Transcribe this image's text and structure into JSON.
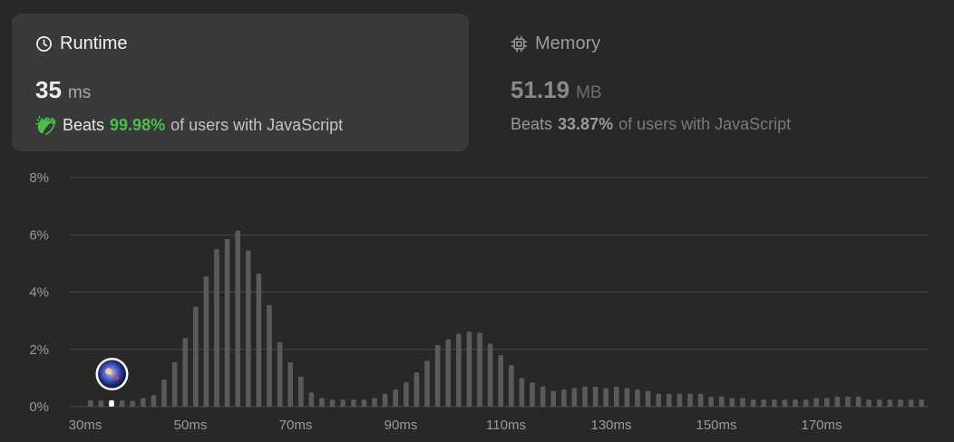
{
  "runtime_card": {
    "title": "Runtime",
    "icon": "clock-icon",
    "value": "35",
    "unit": "ms",
    "beats_label": "Beats",
    "beats_percent": "99.98%",
    "beats_tail": "of users with JavaScript",
    "beats_icon": "clapping-hands-icon"
  },
  "memory_card": {
    "title": "Memory",
    "icon": "chip-icon",
    "value": "51.19",
    "unit": "MB",
    "beats_label": "Beats",
    "beats_percent": "33.87%",
    "beats_tail": "of users with JavaScript"
  },
  "colors": {
    "background": "#282828",
    "active_card": "#393939",
    "accent_green": "#4bbf4b",
    "bar": "#5a5a5a",
    "bar_highlight": "#ffffff",
    "grid": "#4a4a4a"
  },
  "chart_data": {
    "type": "bar",
    "title": "",
    "xlabel": "",
    "ylabel": "",
    "ylim": [
      0,
      8
    ],
    "y_ticks": [
      "8%",
      "6%",
      "4%",
      "2%",
      "0%"
    ],
    "x_ticks": [
      "30ms",
      "50ms",
      "70ms",
      "90ms",
      "110ms",
      "130ms",
      "150ms",
      "170ms"
    ],
    "x_tick_values": [
      30,
      50,
      70,
      90,
      110,
      130,
      150,
      170
    ],
    "x": [
      31,
      33,
      35,
      37,
      39,
      41,
      43,
      45,
      47,
      49,
      51,
      53,
      55,
      57,
      59,
      61,
      63,
      65,
      67,
      69,
      71,
      73,
      75,
      77,
      79,
      81,
      83,
      85,
      87,
      89,
      91,
      93,
      95,
      97,
      99,
      101,
      103,
      105,
      107,
      109,
      111,
      113,
      115,
      117,
      119,
      121,
      123,
      125,
      127,
      129,
      131,
      133,
      135,
      137,
      139,
      141,
      143,
      145,
      147,
      149,
      151,
      153,
      155,
      157,
      159,
      161,
      163,
      165,
      167,
      169,
      171,
      173,
      175,
      177,
      179,
      181,
      183,
      185,
      187,
      189
    ],
    "values": [
      0.22,
      0.22,
      0.22,
      0.22,
      0.2,
      0.3,
      0.4,
      0.95,
      1.55,
      2.4,
      3.5,
      4.55,
      5.5,
      5.85,
      6.15,
      5.45,
      4.65,
      3.55,
      2.25,
      1.55,
      1.05,
      0.5,
      0.3,
      0.25,
      0.25,
      0.25,
      0.25,
      0.3,
      0.45,
      0.6,
      0.85,
      1.2,
      1.6,
      2.15,
      2.35,
      2.55,
      2.62,
      2.58,
      2.2,
      1.8,
      1.45,
      1.0,
      0.85,
      0.7,
      0.55,
      0.6,
      0.65,
      0.7,
      0.7,
      0.65,
      0.7,
      0.65,
      0.6,
      0.55,
      0.45,
      0.45,
      0.45,
      0.45,
      0.45,
      0.35,
      0.35,
      0.3,
      0.3,
      0.25,
      0.25,
      0.25,
      0.25,
      0.25,
      0.25,
      0.3,
      0.3,
      0.35,
      0.35,
      0.35,
      0.25,
      0.25,
      0.25,
      0.25,
      0.25,
      0.25
    ],
    "user_bar_x": 35
  }
}
